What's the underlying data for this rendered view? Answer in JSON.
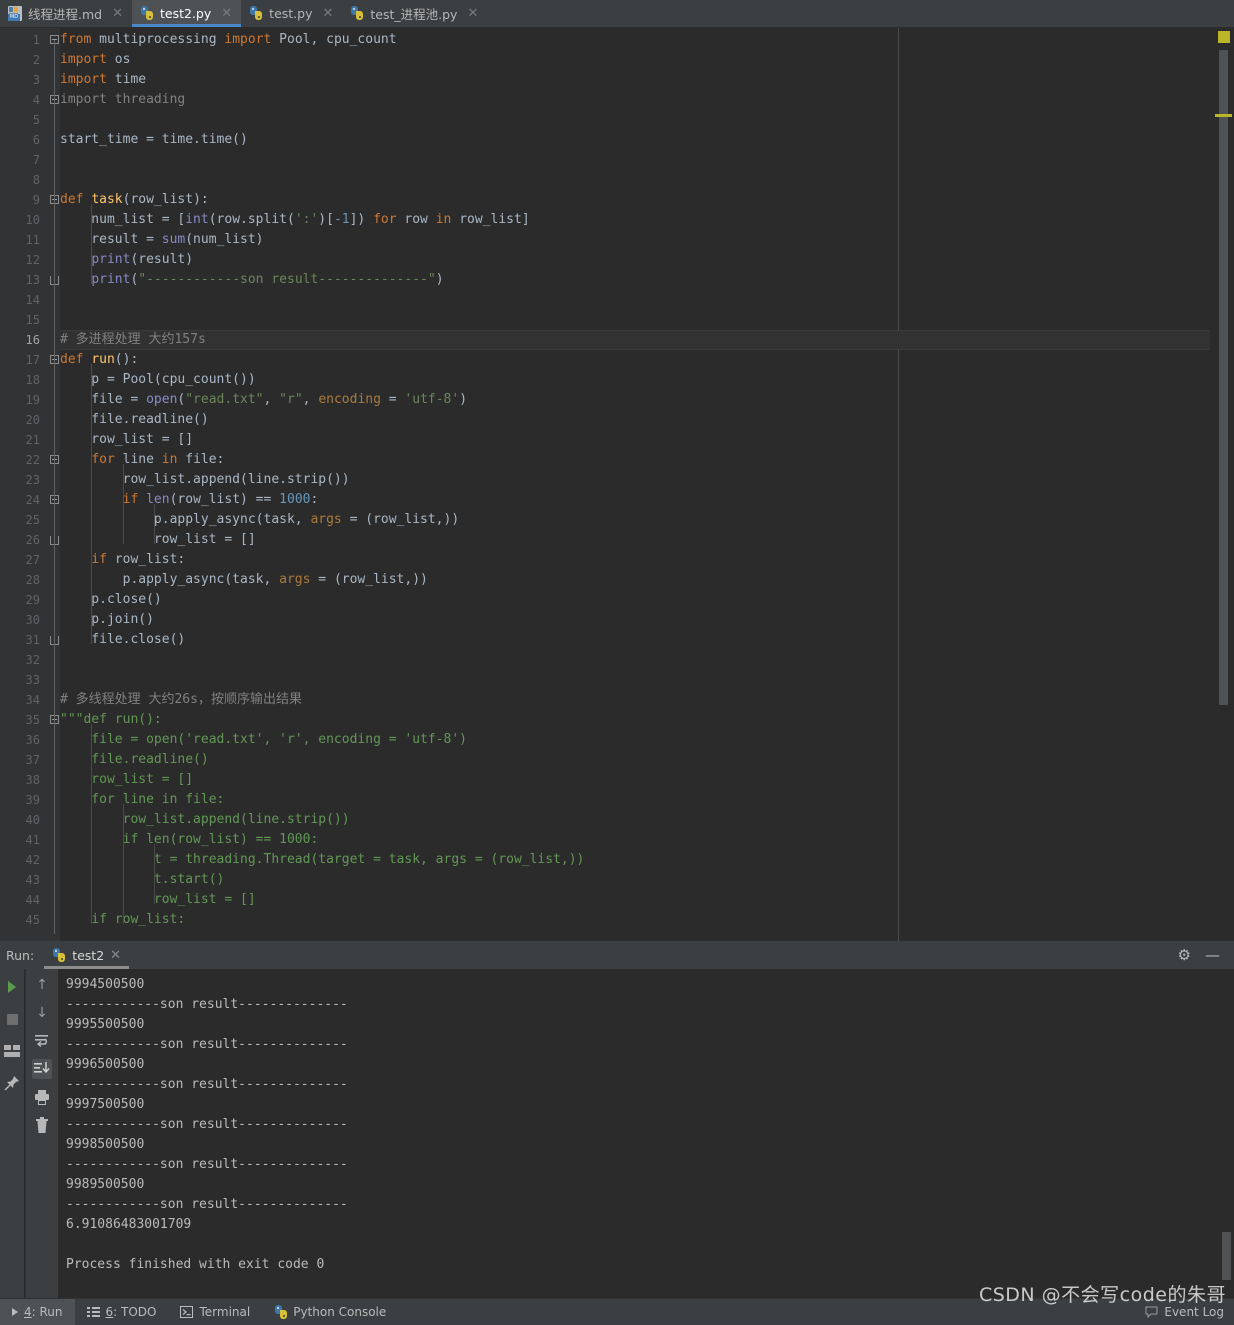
{
  "tabs": [
    {
      "label": "线程进程.md",
      "icon": "markdown-file-icon",
      "active": false
    },
    {
      "label": "test2.py",
      "icon": "python-file-icon",
      "active": true
    },
    {
      "label": "test.py",
      "icon": "python-file-icon",
      "active": false
    },
    {
      "label": "test_进程池.py",
      "icon": "python-file-icon",
      "active": false
    }
  ],
  "editor": {
    "current_line": 16,
    "lines": [
      {
        "n": 1,
        "fold": "open",
        "html": "<span class=\"kw\">from</span> multiprocessing <span class=\"kw\">import</span> Pool, cpu_count"
      },
      {
        "n": 2,
        "fold": "",
        "html": "<span class=\"kw\">import</span> os"
      },
      {
        "n": 3,
        "fold": "",
        "html": "<span class=\"kw\">import</span> time"
      },
      {
        "n": 4,
        "fold": "box",
        "html": "<span class=\"gray\">import threading</span>"
      },
      {
        "n": 5,
        "fold": "",
        "html": ""
      },
      {
        "n": 6,
        "fold": "",
        "html": "start_time = time.time()"
      },
      {
        "n": 7,
        "fold": "",
        "html": ""
      },
      {
        "n": 8,
        "fold": "",
        "html": ""
      },
      {
        "n": 9,
        "fold": "open",
        "html": "<span class=\"kw\">def</span> <span class=\"fn\">task</span>(row_list):"
      },
      {
        "n": 10,
        "fold": "",
        "html": "    num_list = [<span class=\"bi\">int</span>(row.split(<span class=\"str\">':'</span>)[<span class=\"num\">-1</span>]) <span class=\"kw\">for</span> row <span class=\"kw\">in</span> row_list]"
      },
      {
        "n": 11,
        "fold": "",
        "html": "    result = <span class=\"bi\">sum</span>(num_list)"
      },
      {
        "n": 12,
        "fold": "",
        "html": "    <span class=\"bi\">print</span>(result)"
      },
      {
        "n": 13,
        "fold": "end",
        "html": "    <span class=\"bi\">print</span>(<span class=\"str\">\"------------son result--------------\"</span>)"
      },
      {
        "n": 14,
        "fold": "",
        "html": ""
      },
      {
        "n": 15,
        "fold": "",
        "html": ""
      },
      {
        "n": 16,
        "fold": "",
        "html": "<span class=\"cmt\"># 多进程处理 大约157s</span>"
      },
      {
        "n": 17,
        "fold": "open",
        "html": "<span class=\"kw\">def</span> <span class=\"fn\">run</span>():"
      },
      {
        "n": 18,
        "fold": "",
        "html": "    p = Pool(cpu_count())"
      },
      {
        "n": 19,
        "fold": "",
        "html": "    file = <span class=\"bi\">open</span>(<span class=\"str\">\"read.txt\"</span>, <span class=\"str\">\"r\"</span>, <span class=\"kwarg\">encoding</span> = <span class=\"str\">'utf-8'</span>)"
      },
      {
        "n": 20,
        "fold": "",
        "html": "    file.readline()"
      },
      {
        "n": 21,
        "fold": "",
        "html": "    row_list = []"
      },
      {
        "n": 22,
        "fold": "open",
        "html": "    <span class=\"kw\">for</span> line <span class=\"kw\">in</span> file:"
      },
      {
        "n": 23,
        "fold": "",
        "html": "        row_list.append(line.strip())"
      },
      {
        "n": 24,
        "fold": "open",
        "html": "        <span class=\"kw\">if</span> <span class=\"bi\">len</span>(row_list) == <span class=\"num\">1000</span>:"
      },
      {
        "n": 25,
        "fold": "",
        "html": "            p.apply_async(task, <span class=\"kwarg\">args</span> = (row_list,))"
      },
      {
        "n": 26,
        "fold": "end",
        "html": "            row_list = []"
      },
      {
        "n": 27,
        "fold": "",
        "html": "    <span class=\"kw\">if</span> row_list:"
      },
      {
        "n": 28,
        "fold": "",
        "html": "        p.apply_async(task, <span class=\"kwarg\">args</span> = (row_list,))"
      },
      {
        "n": 29,
        "fold": "",
        "html": "    p.close()"
      },
      {
        "n": 30,
        "fold": "",
        "html": "    p.join()"
      },
      {
        "n": 31,
        "fold": "end",
        "html": "    file.close()"
      },
      {
        "n": 32,
        "fold": "",
        "html": ""
      },
      {
        "n": 33,
        "fold": "",
        "html": ""
      },
      {
        "n": 34,
        "fold": "",
        "html": "<span class=\"cmt\"># 多线程处理 大约26s，按顺序输出结果</span>"
      },
      {
        "n": 35,
        "fold": "open",
        "html": "<span class=\"blkstr\">\"\"\"def run():</span>"
      },
      {
        "n": 36,
        "fold": "",
        "html": "<span class=\"blkstr\">    file = open('read.txt', 'r', encoding = 'utf-8')</span>"
      },
      {
        "n": 37,
        "fold": "",
        "html": "<span class=\"blkstr\">    file.readline()</span>"
      },
      {
        "n": 38,
        "fold": "",
        "html": "<span class=\"blkstr\">    row_list = []</span>"
      },
      {
        "n": 39,
        "fold": "",
        "html": "<span class=\"blkstr\">    for line in file:</span>"
      },
      {
        "n": 40,
        "fold": "",
        "html": "<span class=\"blkstr\">        row_list.append(line.strip())</span>"
      },
      {
        "n": 41,
        "fold": "",
        "html": "<span class=\"blkstr\">        if len(row_list) == 1000:</span>"
      },
      {
        "n": 42,
        "fold": "",
        "html": "<span class=\"blkstr\">            t = threading.Thread(target = task, args = (row_list,))</span>"
      },
      {
        "n": 43,
        "fold": "",
        "html": "<span class=\"blkstr\">            t.start()</span>"
      },
      {
        "n": 44,
        "fold": "",
        "html": "<span class=\"blkstr\">            row_list = []</span>"
      },
      {
        "n": 45,
        "fold": "",
        "html": "<span class=\"blkstr\">    if row_list:</span>"
      }
    ]
  },
  "run_panel": {
    "label": "Run:",
    "tab_label": "test2",
    "tab_icon": "python-file-icon",
    "close_icon": "close-icon",
    "settings_icon": "gear-icon",
    "minimize_icon": "minimize-icon",
    "left_tools": [
      {
        "name": "rerun-button",
        "glyph": "run-triangle-icon"
      },
      {
        "name": "stop-button",
        "glyph": "stop-square-icon"
      },
      {
        "name": "restore-layout-button",
        "glyph": "layout-icon"
      },
      {
        "name": "pin-tab-button",
        "glyph": "pin-icon"
      }
    ],
    "left_tools2": [
      {
        "name": "up-the-stack-trace-button",
        "glyph": "arrow-up-icon"
      },
      {
        "name": "down-the-stack-trace-button",
        "glyph": "arrow-down-icon"
      },
      {
        "name": "soft-wrap-button",
        "glyph": "soft-wrap-icon"
      },
      {
        "name": "scroll-to-end-button",
        "glyph": "scroll-to-end-icon"
      },
      {
        "name": "print-button",
        "glyph": "printer-icon"
      },
      {
        "name": "clear-all-button",
        "glyph": "trash-icon"
      }
    ],
    "console_lines": [
      "------------son result--------------",
      "9994500500",
      "------------son result--------------",
      "9995500500",
      "------------son result--------------",
      "9996500500",
      "------------son result--------------",
      "9997500500",
      "------------son result--------------",
      "9998500500",
      "------------son result--------------",
      "9989500500",
      "------------son result--------------",
      "6.91086483001709",
      "",
      "Process finished with exit code 0"
    ]
  },
  "status_bar": {
    "items": [
      {
        "name": "status-run",
        "num": "4",
        "label": ": Run",
        "icon": "run-triangle-icon",
        "selected": true
      },
      {
        "name": "status-todo",
        "num": "6",
        "label": ": TODO",
        "icon": "list-icon",
        "selected": false
      },
      {
        "name": "status-terminal",
        "num": "",
        "label": "Terminal",
        "icon": "terminal-icon",
        "selected": false
      },
      {
        "name": "status-python-console",
        "num": "",
        "label": "Python Console",
        "icon": "python-icon",
        "selected": false
      }
    ],
    "event_log": "Event Log",
    "event_log_icon": "event-log-icon"
  },
  "watermark": "CSDN @不会写code的朱哥",
  "colors": {
    "accent_blue": "#4a88c7",
    "editor_bg": "#2b2b2b",
    "gutter_bg": "#313335",
    "chrome_bg": "#3c3f41",
    "keyword": "#cc7832",
    "string": "#6a8759",
    "number": "#6897bb",
    "comment": "#808080",
    "function": "#ffc66d",
    "builtin": "#8888c6",
    "text": "#a9b7c6",
    "warning_marker": "#bbb529"
  }
}
